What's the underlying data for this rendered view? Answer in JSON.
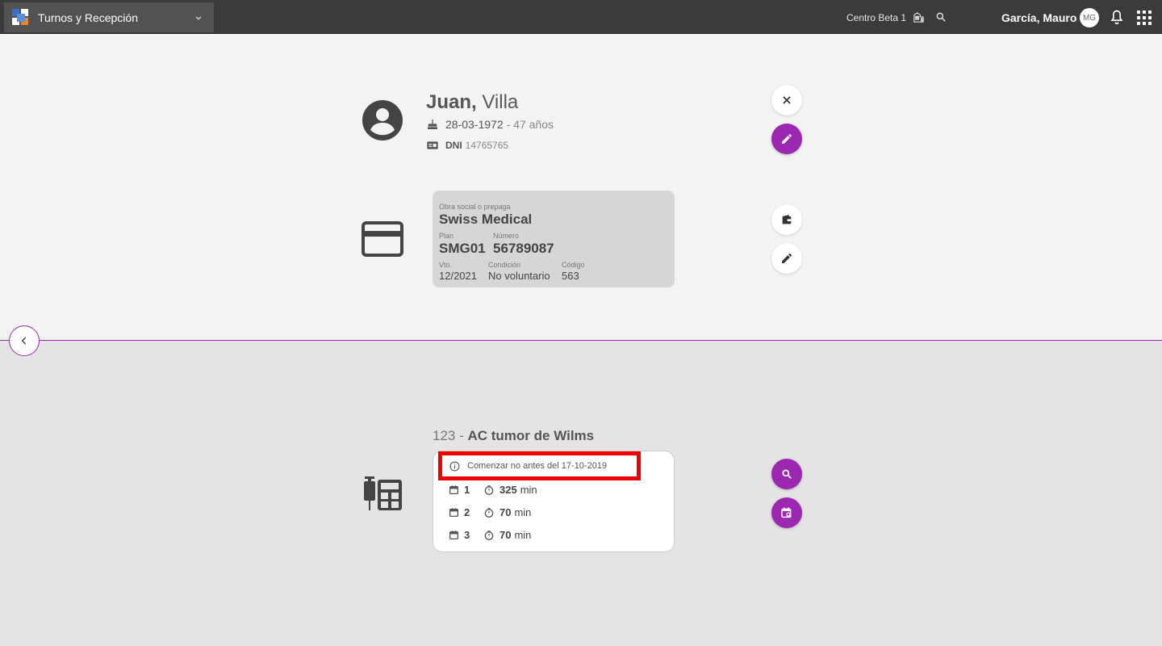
{
  "topbar": {
    "app_title": "Turnos y Recepción",
    "center_name": "Centro Beta 1",
    "user_name": "García, Mauro",
    "user_initials": "MG"
  },
  "patient": {
    "first_name": "Juan,",
    "last_name": "Villa",
    "birth_date": "28-03-1972",
    "age": "- 47 años",
    "doc_type": "DNI",
    "doc_number": "14765765"
  },
  "insurance": {
    "provider_label": "Obra social o prepaga",
    "provider": "Swiss Medical",
    "plan_label": "Plan",
    "plan": "SMG01",
    "number_label": "Número",
    "number": "56789087",
    "expiry_label": "Vto.",
    "expiry": "12/2021",
    "condition_label": "Condición",
    "condition": "No voluntario",
    "code_label": "Código",
    "code": "563"
  },
  "study": {
    "code": "123 -",
    "name": "AC tumor de Wilms",
    "notice": "Comenzar no antes del 17-10-2019",
    "sessions": [
      {
        "num": "1",
        "duration": "325",
        "unit": "min"
      },
      {
        "num": "2",
        "duration": "70",
        "unit": "min"
      },
      {
        "num": "3",
        "duration": "70",
        "unit": "min"
      }
    ]
  },
  "colors": {
    "accent": "#9c27b0",
    "topbar": "#3b3b3b",
    "highlight": "#f20000"
  }
}
